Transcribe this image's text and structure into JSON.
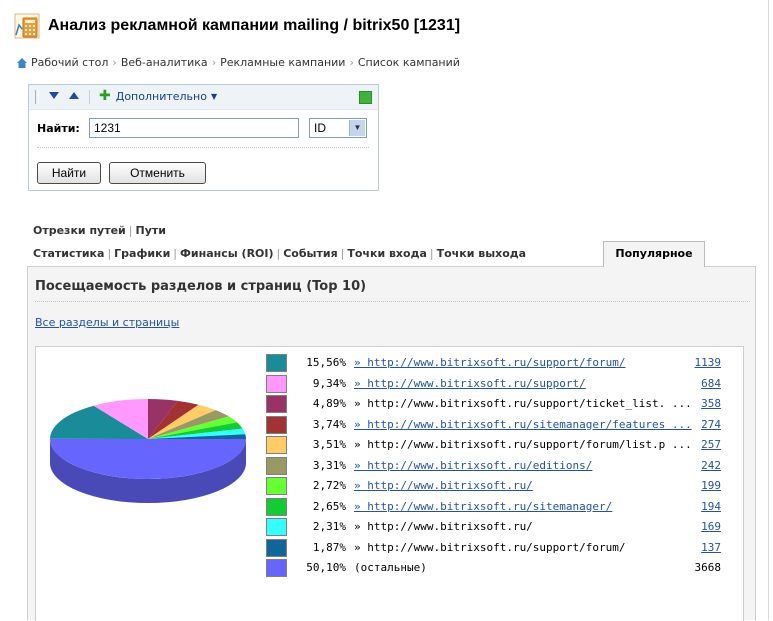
{
  "title": "Анализ рекламной кампании mailing / bitrix50 [1231]",
  "breadcrumb": [
    "Рабочий стол",
    "Веб-аналитика",
    "Рекламные кампании",
    "Список кампаний"
  ],
  "filter": {
    "more_label": "Дополнительно",
    "find_label": "Найти:",
    "find_value": "1231",
    "field_selected": "ID",
    "find_button": "Найти",
    "cancel_button": "Отменить"
  },
  "subtabs": [
    "Отрезки путей",
    "Пути"
  ],
  "tabs": [
    "Статистика",
    "Графики",
    "Финансы (ROI)",
    "События",
    "Точки входа",
    "Точки выхода",
    "Популярное"
  ],
  "panel": {
    "title": "Посещаемость разделов и страниц (Top 10)",
    "all_link": "Все разделы и страницы"
  },
  "chart_data": {
    "type": "pie",
    "slices": [
      {
        "percent": "15,56%",
        "value": 15.56,
        "label": "http://www.bitrixsoft.ru/support/forum/",
        "count": "1139",
        "color": "#1a8c99",
        "linked": true
      },
      {
        "percent": "9,34%",
        "value": 9.34,
        "label": "http://www.bitrixsoft.ru/support/",
        "count": "684",
        "color": "#ff99ff",
        "linked": true
      },
      {
        "percent": "4,89%",
        "value": 4.89,
        "label": "http://www.bitrixsoft.ru/support/ticket_list. ...",
        "count": "358",
        "color": "#993366",
        "linked": false
      },
      {
        "percent": "3,74%",
        "value": 3.74,
        "label": "http://www.bitrixsoft.ru/sitemanager/features ...",
        "count": "274",
        "color": "#a33333",
        "linked": true
      },
      {
        "percent": "3,51%",
        "value": 3.51,
        "label": "http://www.bitrixsoft.ru/support/forum/list.p ...",
        "count": "257",
        "color": "#ffcc66",
        "linked": false
      },
      {
        "percent": "3,31%",
        "value": 3.31,
        "label": "http://www.bitrixsoft.ru/editions/",
        "count": "242",
        "color": "#999966",
        "linked": true
      },
      {
        "percent": "2,72%",
        "value": 2.72,
        "label": "http://www.bitrixsoft.ru/",
        "count": "199",
        "color": "#66ff33",
        "linked": true
      },
      {
        "percent": "2,65%",
        "value": 2.65,
        "label": "http://www.bitrixsoft.ru/sitemanager/",
        "count": "194",
        "color": "#11cc33",
        "linked": true
      },
      {
        "percent": "2,31%",
        "value": 2.31,
        "label": "http://www.bitrixsoft.ru/",
        "count": "169",
        "color": "#33ffff",
        "linked": false
      },
      {
        "percent": "1,87%",
        "value": 1.87,
        "label": "http://www.bitrixsoft.ru/support/forum/",
        "count": "137",
        "color": "#116699",
        "linked": false
      },
      {
        "percent": "50,10%",
        "value": 50.1,
        "label": "(остальные)",
        "count": "3668",
        "color": "#6666ff",
        "linked": false,
        "rest": true
      }
    ]
  }
}
